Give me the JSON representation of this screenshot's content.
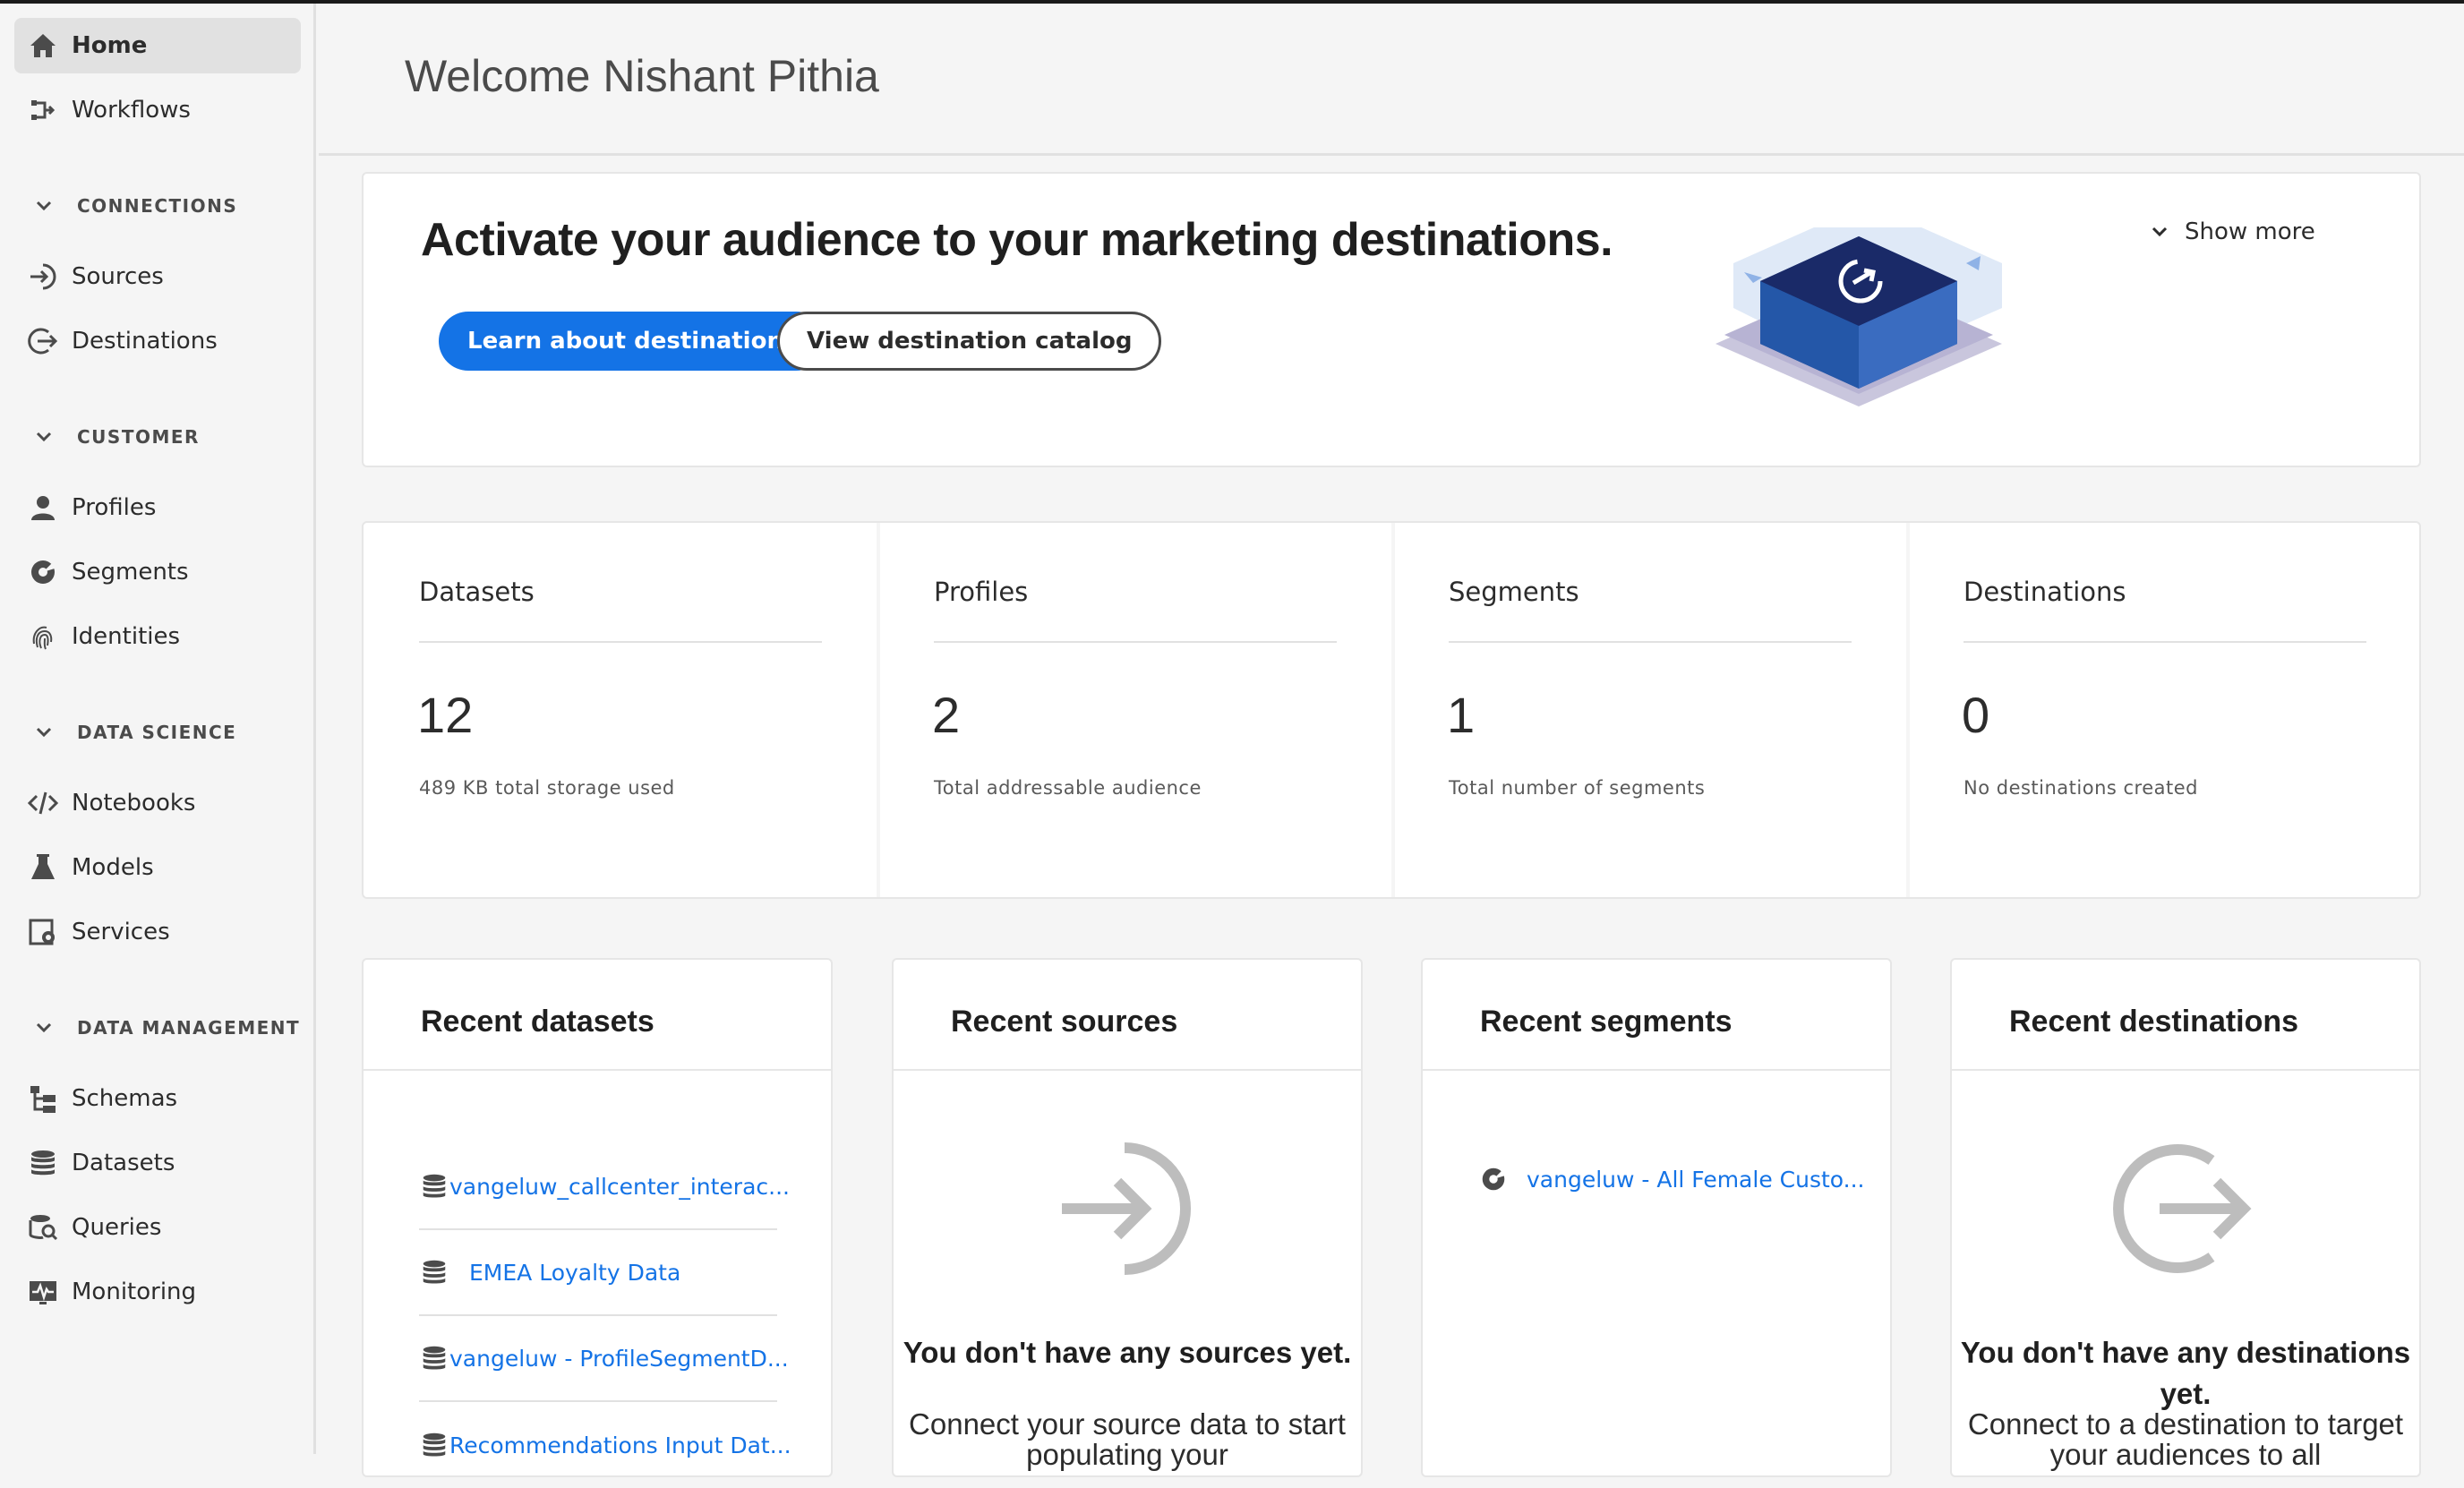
{
  "sidebar": {
    "items": [
      {
        "label": "Home",
        "icon": "home-icon"
      },
      {
        "label": "Workflows",
        "icon": "workflows-icon"
      },
      {
        "label": "Sources",
        "icon": "sources-icon"
      },
      {
        "label": "Destinations",
        "icon": "destinations-icon"
      },
      {
        "label": "Profiles",
        "icon": "profiles-icon"
      },
      {
        "label": "Segments",
        "icon": "segments-icon"
      },
      {
        "label": "Identities",
        "icon": "fingerprint-icon"
      },
      {
        "label": "Notebooks",
        "icon": "code-icon"
      },
      {
        "label": "Models",
        "icon": "flask-icon"
      },
      {
        "label": "Services",
        "icon": "services-icon"
      },
      {
        "label": "Schemas",
        "icon": "schemas-icon"
      },
      {
        "label": "Datasets",
        "icon": "database-icon"
      },
      {
        "label": "Queries",
        "icon": "queries-icon"
      },
      {
        "label": "Monitoring",
        "icon": "monitoring-icon"
      }
    ],
    "sections": {
      "connections": "CONNECTIONS",
      "customer": "CUSTOMER",
      "data_science": "DATA SCIENCE",
      "data_management": "DATA MANAGEMENT"
    }
  },
  "header": {
    "welcome": "Welcome Nishant Pithia"
  },
  "hero": {
    "title": "Activate your audience to your marketing destinations.",
    "primary_button": "Learn about destinations",
    "secondary_button": "View destination catalog",
    "show_more": "Show more"
  },
  "stats": [
    {
      "label": "Datasets",
      "value": "12",
      "desc": "489 KB total storage used"
    },
    {
      "label": "Profiles",
      "value": "2",
      "desc": "Total addressable audience"
    },
    {
      "label": "Segments",
      "value": "1",
      "desc": "Total number of segments"
    },
    {
      "label": "Destinations",
      "value": "0",
      "desc": "No destinations created"
    }
  ],
  "recent": {
    "datasets": {
      "title": "Recent datasets",
      "items": [
        "vangeluw_callcenter_interac...",
        "EMEA Loyalty Data",
        "vangeluw - ProfileSegmentD...",
        "Recommendations Input Dat..."
      ]
    },
    "sources": {
      "title": "Recent sources",
      "empty_title": "You don't have any sources yet.",
      "empty_body": "Connect your source data to start populating your"
    },
    "segments": {
      "title": "Recent segments",
      "items": [
        "vangeluw - All Female Custo..."
      ]
    },
    "destinations": {
      "title": "Recent destinations",
      "empty_title": "You don't have any destinations yet.",
      "empty_body": "Connect to a destination to target your audiences to all"
    }
  },
  "colors": {
    "accent": "#1473e6",
    "text": "#2c2c2c",
    "background": "#f5f5f5"
  }
}
